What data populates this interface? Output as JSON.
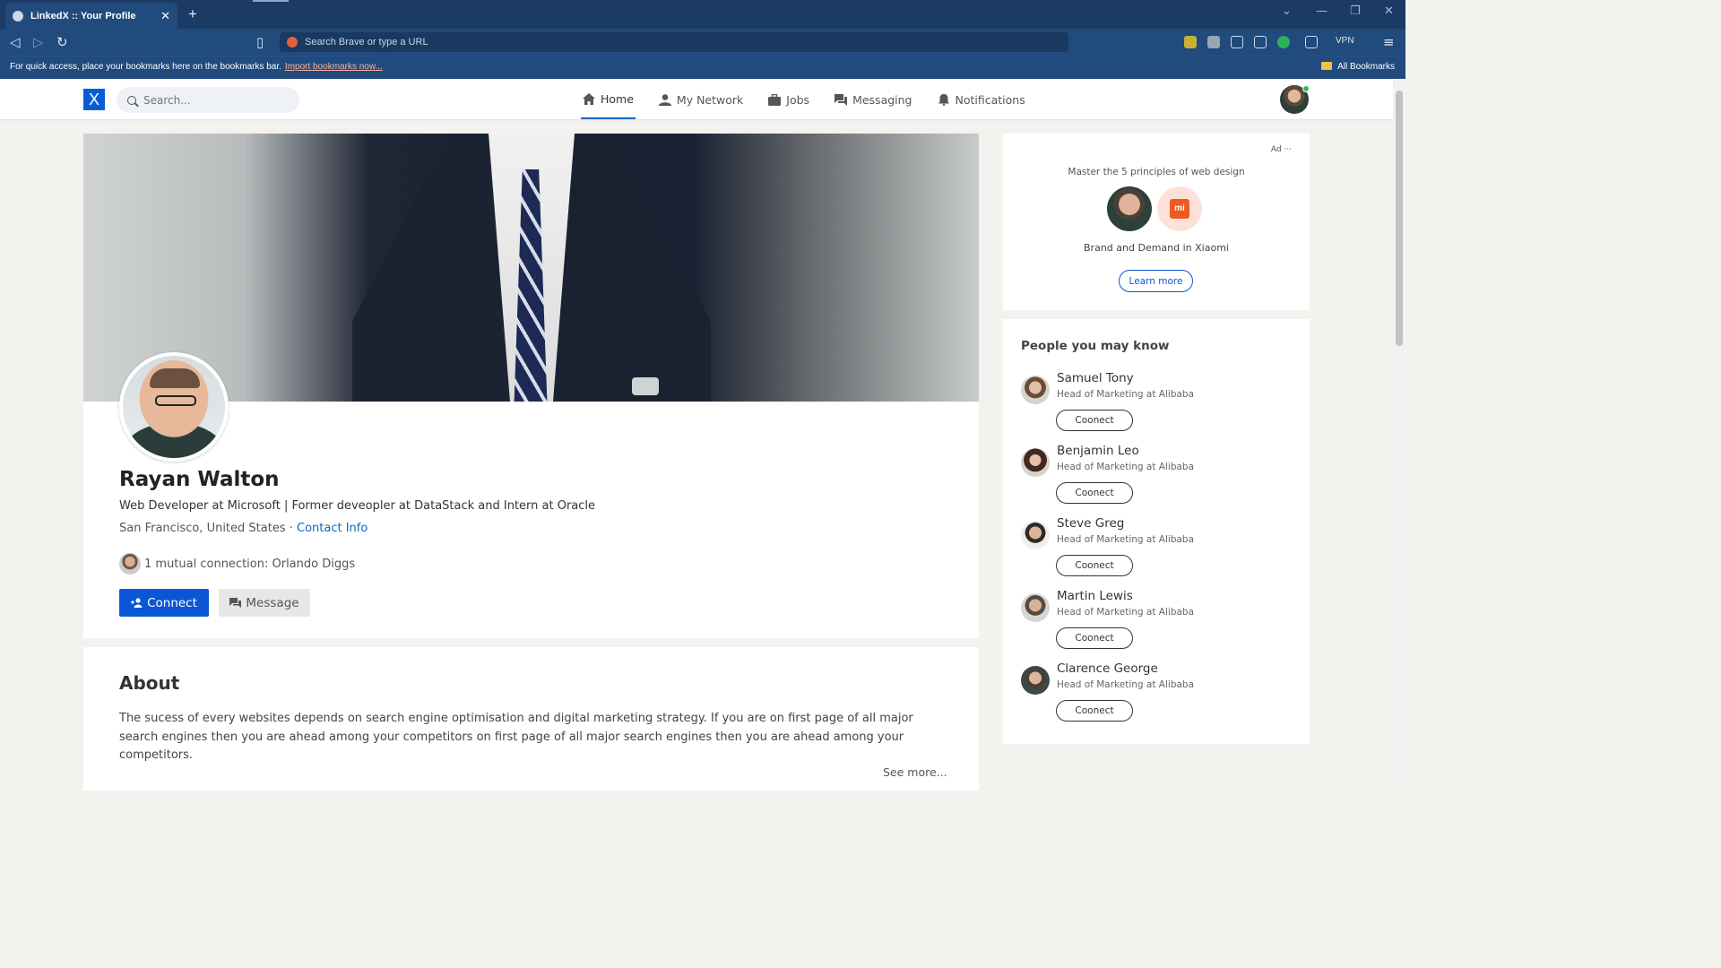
{
  "browser": {
    "tab_title": "LinkedX :: Your Profile",
    "tab_close": "✕",
    "new_tab": "+",
    "url_placeholder": "Search Brave or type a URL",
    "vpn_label": "VPN",
    "bookmarks_message": "For quick access, place your bookmarks here on the bookmarks bar.",
    "import_link": "Import bookmarks now...",
    "all_bookmarks": "All Bookmarks"
  },
  "header": {
    "logo": "X",
    "search_placeholder": "Search...",
    "nav": [
      {
        "label": "Home",
        "icon": "home-icon"
      },
      {
        "label": "My Network",
        "icon": "person-icon"
      },
      {
        "label": "Jobs",
        "icon": "briefcase-icon"
      },
      {
        "label": "Messaging",
        "icon": "chat-icon"
      },
      {
        "label": "Notifications",
        "icon": "bell-icon"
      }
    ]
  },
  "profile": {
    "name": "Rayan Walton",
    "headline": "Web Developer at Microsoft | Former deveopler at DataStack and Intern at Oracle",
    "location": "San Francisco, United States · ",
    "contact_info": "Contact Info",
    "mutual": "1 mutual connection: Orlando Diggs",
    "connect_label": "Connect",
    "message_label": "Message"
  },
  "about": {
    "title": "About",
    "text": "The sucess of every websites depends on search engine optimisation and digital marketing strategy. If you are on first page of all major search engines then you are ahead among your competitors on first page of all major search engines then you are ahead among your competitors.",
    "see_more": "See more..."
  },
  "ad": {
    "label": "Ad ···",
    "text": "Master the 5 principles of web design",
    "brand_logo": "mi",
    "sub": "Brand and Demand in Xiaomi",
    "button": "Learn more"
  },
  "pymk": {
    "title": "People you may know",
    "people": [
      {
        "name": "Samuel Tony",
        "role": "Head of Marketing at Alibaba",
        "button": "Coonect"
      },
      {
        "name": "Benjamin Leo",
        "role": "Head of Marketing at Alibaba",
        "button": "Coonect"
      },
      {
        "name": "Steve Greg",
        "role": "Head of Marketing at Alibaba",
        "button": "Coonect"
      },
      {
        "name": "Martin Lewis",
        "role": "Head of Marketing at Alibaba",
        "button": "Coonect"
      },
      {
        "name": "Clarence George",
        "role": "Head of Marketing at Alibaba",
        "button": "Coonect"
      }
    ]
  },
  "colors": {
    "brand": "#0a56d6",
    "chrome": "#214a7d",
    "link": "#0a66c2"
  }
}
